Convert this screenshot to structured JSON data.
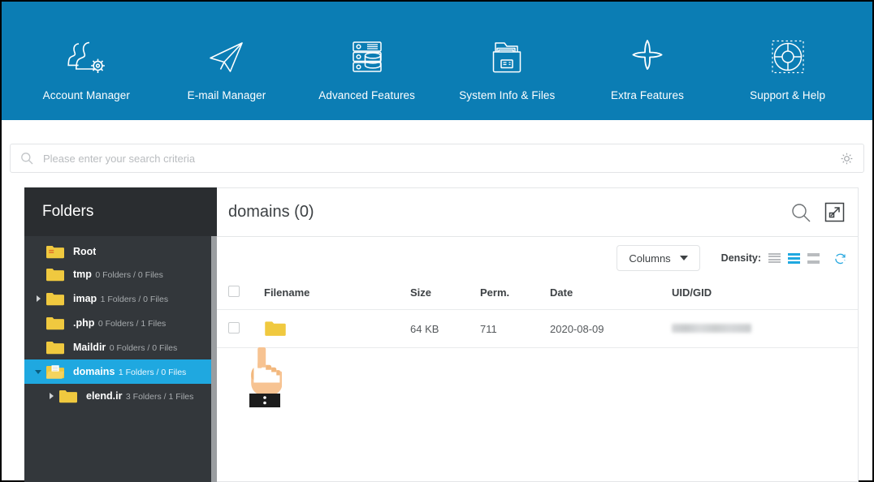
{
  "colors": {
    "header_blue": "#0b7db4",
    "accent_cyan": "#1fa8e0",
    "sidebar_dark": "#33373b",
    "sidebar_title_dark": "#2a2d30",
    "folder_yellow": "#f0c93f",
    "text_dark": "#3d4144"
  },
  "topnav": {
    "items": [
      {
        "label": "Account Manager",
        "icon": "users-gear-icon"
      },
      {
        "label": "E-mail Manager",
        "icon": "paper-plane-icon"
      },
      {
        "label": "Advanced Features",
        "icon": "server-database-icon"
      },
      {
        "label": "System Info & Files",
        "icon": "folder-documents-icon"
      },
      {
        "label": "Extra Features",
        "icon": "plus-icon"
      },
      {
        "label": "Support & Help",
        "icon": "life-ring-icon"
      }
    ]
  },
  "search": {
    "placeholder": "Please enter your search criteria",
    "value": "",
    "icon": "search-icon",
    "settings_icon": "gear-icon"
  },
  "sidebar": {
    "title": "Folders",
    "items": [
      {
        "name": "Root",
        "sub": "",
        "caret": "none",
        "indent": 0,
        "selected": false,
        "icon": "folder-lines-icon"
      },
      {
        "name": "tmp",
        "sub": "0 Folders / 0 Files",
        "caret": "none",
        "indent": 0,
        "selected": false,
        "icon": "folder-icon"
      },
      {
        "name": "imap",
        "sub": "1 Folders / 0 Files",
        "caret": "right",
        "indent": 0,
        "selected": false,
        "icon": "folder-icon"
      },
      {
        "name": ".php",
        "sub": "0 Folders / 1 Files",
        "caret": "none",
        "indent": 0,
        "selected": false,
        "icon": "folder-icon"
      },
      {
        "name": "Maildir",
        "sub": "0 Folders / 0 Files",
        "caret": "none",
        "indent": 0,
        "selected": false,
        "icon": "folder-icon"
      },
      {
        "name": "domains",
        "sub": "1 Folders / 0 Files",
        "caret": "down",
        "indent": 0,
        "selected": true,
        "icon": "folder-open-icon"
      },
      {
        "name": "elend.ir",
        "sub": "3 Folders / 1 Files",
        "caret": "right",
        "indent": 1,
        "selected": false,
        "icon": "folder-icon"
      }
    ]
  },
  "content": {
    "title": "domains  (0)",
    "search_icon": "search-icon",
    "expand_icon": "expand-icon",
    "toolbar": {
      "columns_label": "Columns",
      "density_label": "Density:",
      "density_options": [
        "compact",
        "standard",
        "comfortable"
      ],
      "density_selected": "standard",
      "refresh_icon": "refresh-icon"
    },
    "table": {
      "headers": [
        "",
        "Filename",
        "Size",
        "Perm.",
        "Date",
        "UID/GID"
      ],
      "rows": [
        {
          "checked": false,
          "filename": "",
          "filename_icon": "folder-icon",
          "size": "64 KB",
          "perm": "711",
          "date": "2020-08-09",
          "uidgid": "",
          "uidgid_redacted": true
        }
      ]
    }
  },
  "cursor": {
    "type": "pointing-hand-cursor"
  }
}
